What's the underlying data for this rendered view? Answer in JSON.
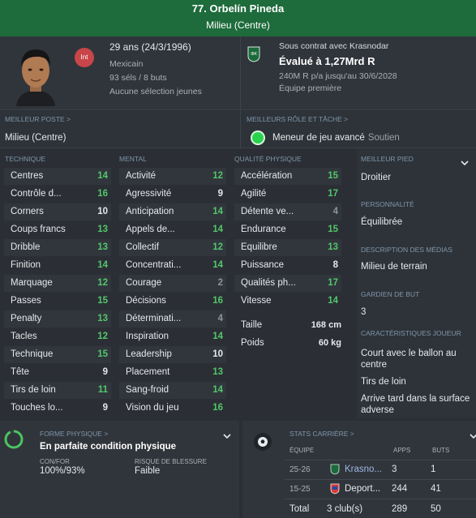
{
  "header": {
    "title": "77. Orbelín Pineda",
    "position": "Milieu (Centre)"
  },
  "info": {
    "age": "29 ans (24/3/1996)",
    "int_badge": "Int",
    "nationality": "Mexicain",
    "caps": "93 séls / 8 buts",
    "youth": "Aucune sélection jeunes",
    "contract": "Sous contrat avec Krasnodar",
    "value": "Évalué à 1,27Mrd R",
    "wage": "240M R p/a jusqu'au 30/6/2028",
    "squad_status": "Équipe première"
  },
  "best_position": {
    "label": "MEILLEUR POSTE >",
    "value": "Milieu (Centre)"
  },
  "best_role": {
    "label": "MEILLEURS RÔLE ET TÂCHE >",
    "role": "Meneur de jeu avancé",
    "duty": "Soutien"
  },
  "attributes": {
    "technique_title": "TECHNIQUE",
    "mental_title": "MENTAL",
    "physical_title": "QUALITÉ PHYSIQUE",
    "technique": [
      {
        "name": "Centres",
        "value": "14",
        "tone": "g"
      },
      {
        "name": "Contrôle d...",
        "value": "16",
        "tone": "g"
      },
      {
        "name": "Corners",
        "value": "10",
        "tone": "w"
      },
      {
        "name": "Coups francs",
        "value": "13",
        "tone": "g"
      },
      {
        "name": "Dribble",
        "value": "13",
        "tone": "g"
      },
      {
        "name": "Finition",
        "value": "14",
        "tone": "g"
      },
      {
        "name": "Marquage",
        "value": "12",
        "tone": "g"
      },
      {
        "name": "Passes",
        "value": "15",
        "tone": "g"
      },
      {
        "name": "Penalty",
        "value": "13",
        "tone": "g"
      },
      {
        "name": "Tacles",
        "value": "12",
        "tone": "g"
      },
      {
        "name": "Technique",
        "value": "15",
        "tone": "g"
      },
      {
        "name": "Tête",
        "value": "9",
        "tone": "w"
      },
      {
        "name": "Tirs de loin",
        "value": "11",
        "tone": "g"
      },
      {
        "name": "Touches lo...",
        "value": "9",
        "tone": "w"
      }
    ],
    "mental": [
      {
        "name": "Activité",
        "value": "12",
        "tone": "g"
      },
      {
        "name": "Agressivité",
        "value": "9",
        "tone": "w"
      },
      {
        "name": "Anticipation",
        "value": "14",
        "tone": "g"
      },
      {
        "name": "Appels de...",
        "value": "14",
        "tone": "g"
      },
      {
        "name": "Collectif",
        "value": "12",
        "tone": "g"
      },
      {
        "name": "Concentrati...",
        "value": "14",
        "tone": "g"
      },
      {
        "name": "Courage",
        "value": "2",
        "tone": "gr"
      },
      {
        "name": "Décisions",
        "value": "16",
        "tone": "g"
      },
      {
        "name": "Déterminati...",
        "value": "4",
        "tone": "gr"
      },
      {
        "name": "Inspiration",
        "value": "14",
        "tone": "g"
      },
      {
        "name": "Leadership",
        "value": "10",
        "tone": "w"
      },
      {
        "name": "Placement",
        "value": "13",
        "tone": "g"
      },
      {
        "name": "Sang-froid",
        "value": "14",
        "tone": "g"
      },
      {
        "name": "Vision du jeu",
        "value": "16",
        "tone": "g"
      }
    ],
    "physical": [
      {
        "name": "Accélération",
        "value": "15",
        "tone": "g"
      },
      {
        "name": "Agilité",
        "value": "17",
        "tone": "g"
      },
      {
        "name": "Détente ve...",
        "value": "4",
        "tone": "gr"
      },
      {
        "name": "Endurance",
        "value": "15",
        "tone": "g"
      },
      {
        "name": "Équilibre",
        "value": "13",
        "tone": "g"
      },
      {
        "name": "Puissance",
        "value": "8",
        "tone": "w"
      },
      {
        "name": "Qualités ph...",
        "value": "17",
        "tone": "g"
      },
      {
        "name": "Vitesse",
        "value": "14",
        "tone": "g"
      }
    ],
    "height_label": "Taille",
    "height_value": "168 cm",
    "weight_label": "Poids",
    "weight_value": "60 kg"
  },
  "sidebar": {
    "foot_label": "MEILLEUR PIED",
    "foot_value": "Droitier",
    "personality_label": "PERSONNALITÉ",
    "personality_value": "Équilibrée",
    "media_label": "DESCRIPTION DES MÉDIAS",
    "media_value": "Milieu de terrain",
    "gk_label": "GARDIEN DE BUT",
    "gk_value": "3",
    "traits_label": "CARACTÉRISTIQUES JOUEUR",
    "traits": [
      "Court avec le ballon au centre",
      "Tirs de loin",
      "Arrive tard dans la surface adverse"
    ]
  },
  "form": {
    "label": "FORME PHYSIQUE >",
    "value": "En parfaite condition physique",
    "conf_label": "CON/FOR",
    "conf_value": "100%/93%",
    "risk_label": "RISQUE DE BLESSURE",
    "risk_value": "Faible"
  },
  "career": {
    "label": "STATS CARRIÈRE >",
    "col_team": "ÉQUIPE",
    "col_apps": "APPS",
    "col_goals": "BUTS",
    "rows": [
      {
        "year": "25-26",
        "team": "Krasno...",
        "apps": "3",
        "goals": "1"
      },
      {
        "year": "15-25",
        "team": "Deport...",
        "apps": "244",
        "goals": "41"
      }
    ],
    "total_label": "Total",
    "total_clubs": "3 club(s)",
    "total_apps": "289",
    "total_goals": "50"
  },
  "colors": {
    "header": "#1e6b3c",
    "good": "#52c76a",
    "role_dot": "#2ad24d",
    "int_badge": "#c8454a"
  }
}
